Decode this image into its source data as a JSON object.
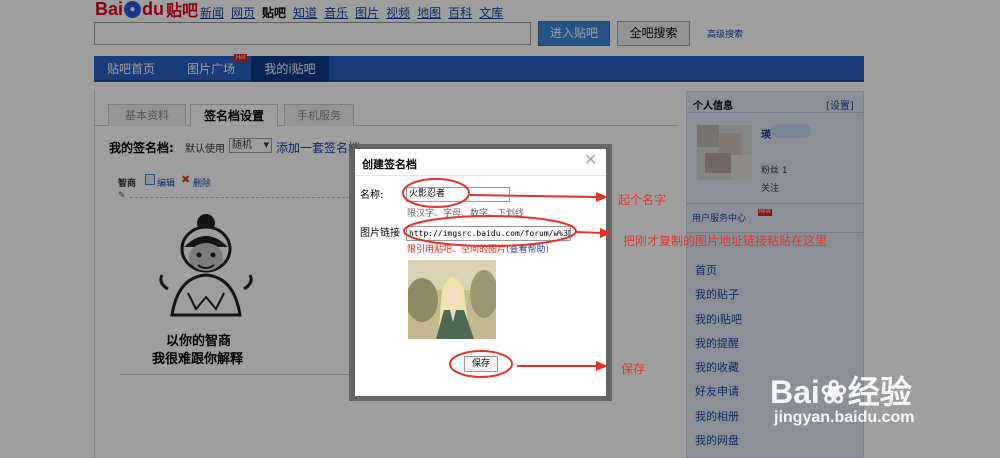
{
  "logo": {
    "bai": "Bai",
    "du": "du",
    "tieba": "贴吧"
  },
  "top_nav": [
    "新闻",
    "网页",
    "贴吧",
    "知道",
    "音乐",
    "图片",
    "视频",
    "地图",
    "百科",
    "文库"
  ],
  "search": {
    "enter_button": "进入贴吧",
    "search_button": "全吧搜索",
    "advanced": "高级搜索"
  },
  "main_nav": {
    "items": [
      "贴吧首页",
      "图片广场",
      "我的i贴吧"
    ],
    "hot_badge": "Hot"
  },
  "tabs": [
    "基本资料",
    "签名档设置",
    "手机服务"
  ],
  "signature": {
    "label": "我的签名档:",
    "default_use": "默认使用",
    "select_value": "随机",
    "add_link": "添加一套签名档",
    "item_name": "智商",
    "edit": "编辑",
    "delete": "删除",
    "meme_line1": "以你的智商",
    "meme_line2": "我很难跟你解释"
  },
  "sidebar": {
    "title": "个人信息",
    "settings": "[设置]",
    "username": "瑛",
    "fans": "粉丝",
    "fans_count": "1",
    "follow": "关注",
    "service": "用户服务中心",
    "new_badge": "NEW",
    "links": [
      "首页",
      "我的贴子",
      "我的i贴吧",
      "我的提醒",
      "我的收藏",
      "好友申请",
      "我的相册",
      "我的网盘"
    ]
  },
  "modal": {
    "title": "创建签名档",
    "name_label": "名称:",
    "name_value": "火影忍者",
    "name_hint": "限汉字、字母、数字、下划线",
    "image_label": "图片链接",
    "image_value": "http://imgsrc.baidu.com/forum/w%3D",
    "image_hint": "限引用贴吧、空间的图片(",
    "image_help": "查看帮助",
    "image_hint_end": ")",
    "save": "保存"
  },
  "annotations": {
    "name": "起个名字",
    "link": "把刚才复制的图片地址链接粘贴在这里",
    "save": "保存",
    "color": "#e3342c"
  },
  "watermark": {
    "logo": "Bai",
    "logo2": "经验",
    "url": "jingyan.baidu.com"
  }
}
